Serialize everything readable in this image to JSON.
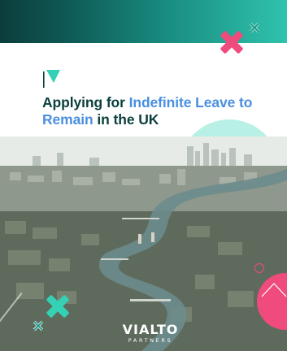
{
  "brand": {
    "mark_icon": "vialto-v-icon",
    "wordmark": "VIALTO",
    "wordmark_sub": "PARTNERS"
  },
  "title": {
    "part1": "Applying for ",
    "highlight": "Indefinite Leave to Remain",
    "part2": " in the UK"
  },
  "colors": {
    "dark_teal": "#0a3f3d",
    "accent_blue": "#4a8fe0",
    "teal": "#35d1b4",
    "pink": "#ef4b7c"
  },
  "decorations": {
    "top_right_cross": "pink-x-icon",
    "bottom_left_cross": "teal-x-icon",
    "outline_crosses": [
      "outline-x-icon",
      "outline-x-icon"
    ]
  },
  "image": {
    "subject": "london-aerial-photo"
  }
}
